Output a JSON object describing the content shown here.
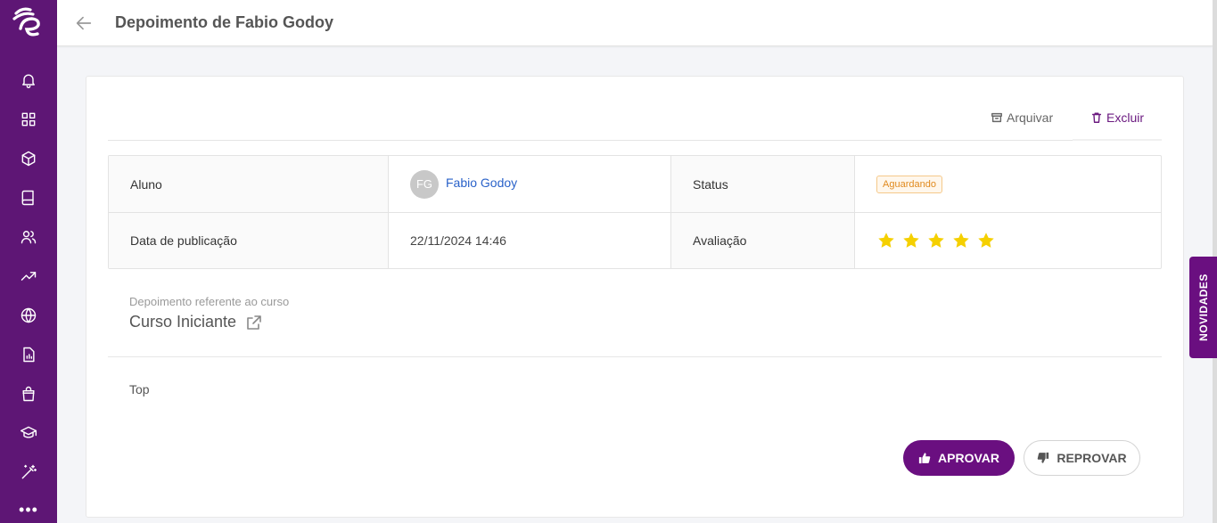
{
  "header": {
    "title": "Depoimento de Fabio Godoy"
  },
  "sidebar": {
    "items": [
      {
        "icon": "bell-icon"
      },
      {
        "icon": "grid-icon"
      },
      {
        "icon": "box-icon"
      },
      {
        "icon": "book-icon"
      },
      {
        "icon": "users-icon"
      },
      {
        "icon": "trending-up-icon"
      },
      {
        "icon": "globe-icon"
      },
      {
        "icon": "report-icon"
      },
      {
        "icon": "shopping-bag-icon"
      },
      {
        "icon": "graduation-cap-icon"
      },
      {
        "icon": "magic-wand-icon"
      }
    ],
    "more_label": "•••"
  },
  "actions": {
    "archive_label": "Arquivar",
    "delete_label": "Excluir"
  },
  "info": {
    "student_label": "Aluno",
    "student_initials": "FG",
    "student_name": "Fabio Godoy",
    "status_label": "Status",
    "status_value": "Aguardando",
    "date_label": "Data de publicação",
    "date_value": "22/11/2024 14:46",
    "rating_label": "Avaliação",
    "rating": 5,
    "rating_max": 5
  },
  "course": {
    "label": "Depoimento referente ao curso",
    "name": "Curso Iniciante"
  },
  "testimony": {
    "text": "Top"
  },
  "buttons": {
    "approve_label": "APROVAR",
    "reject_label": "REPROVAR"
  },
  "side_tab": {
    "label": "NOVIDADES"
  },
  "colors": {
    "brand": "#6a0f80",
    "sidebar": "#5e1675",
    "link": "#2a62c9",
    "star": "#f5d000",
    "badge_text": "#e08a1e"
  }
}
